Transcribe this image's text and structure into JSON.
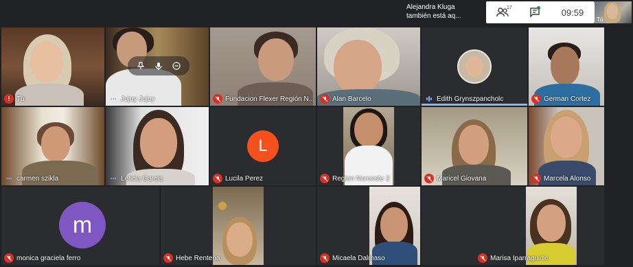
{
  "notification": {
    "line1": "Alejandra Kluga",
    "line2": "también está aq..."
  },
  "top_controls": {
    "people_count": "17",
    "time": "09:59"
  },
  "self_view": {
    "label": "Tú"
  },
  "participants": [
    {
      "name": "Tú",
      "status": "warning"
    },
    {
      "name": "Jujuy Jujuy",
      "status": "speaking-dots"
    },
    {
      "name": "Fundacion Flexer Región N...",
      "status": "muted"
    },
    {
      "name": "Alan Barcelo",
      "status": "muted"
    },
    {
      "name": "Edith Grynszpancholc",
      "status": "speaking-bars"
    },
    {
      "name": "German Cortez",
      "status": "muted"
    },
    {
      "name": "carmen szikla",
      "status": "speaking-dots"
    },
    {
      "name": "Leticia Garcia",
      "status": "speaking-dots"
    },
    {
      "name": "Lucila Perez",
      "status": "muted",
      "avatar_letter": "L",
      "avatar_color": "#f4511e"
    },
    {
      "name": "Region Noroeste 2",
      "status": "muted"
    },
    {
      "name": "Maricel Giovana",
      "status": "muted"
    },
    {
      "name": "Marcela Alonso",
      "status": "muted"
    },
    {
      "name": "monica graciela ferro",
      "status": "muted",
      "avatar_letter": "m",
      "avatar_color": "#7e57c2"
    },
    {
      "name": "Hebe Renteria",
      "status": "muted"
    },
    {
      "name": "Micaela Dalmaso",
      "status": "muted"
    },
    {
      "name": "Marisa Iparraguirre",
      "status": "muted"
    }
  ],
  "colors": {
    "background": "#202124",
    "mute_red": "#d93025",
    "accent_blue": "#8ab4f8"
  }
}
